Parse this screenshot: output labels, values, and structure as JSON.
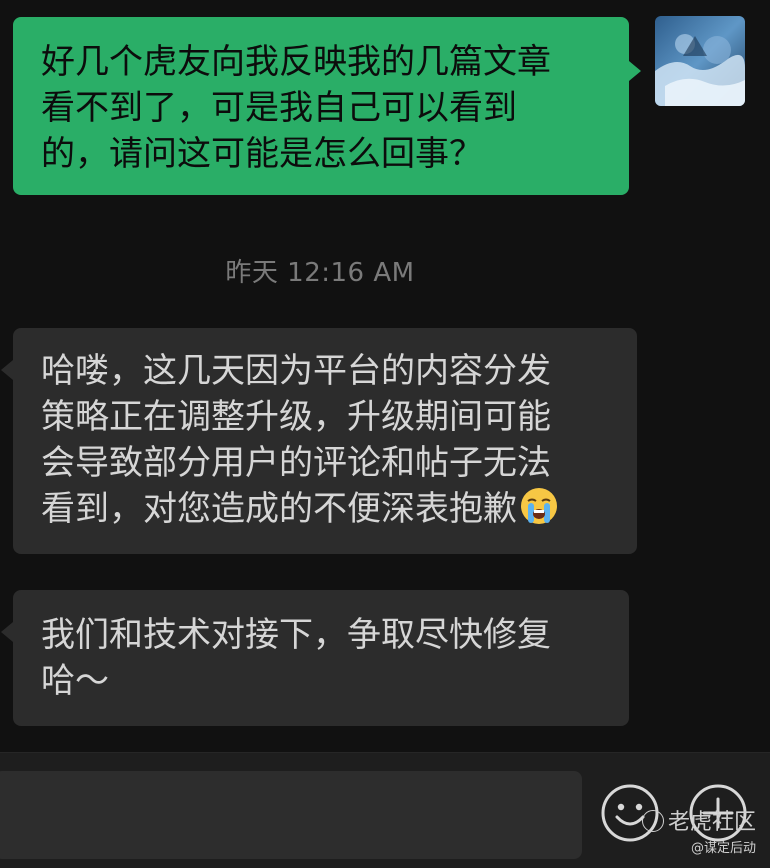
{
  "messages": {
    "outgoing": {
      "lines": [
        "好几个虎友向我反映我的几篇文章",
        "看不到了，可是我自己可以看到",
        "的，请问这可能是怎么回事？"
      ]
    },
    "timestamp": "昨天 12:16 AM",
    "incoming_1": {
      "lines": [
        "哈喽，这几天因为平台的内容分发",
        "策略正在调整升级，升级期间可能",
        "会导致部分用户的评论和帖子无法",
        "看到，对您造成的不便深表抱歉"
      ],
      "emoji": "loudly-crying-face"
    },
    "incoming_2": {
      "lines": [
        "我们和技术对接下，争取尽快修复",
        "哈～"
      ]
    }
  },
  "input_bar": {
    "text_value": "",
    "emoji_icon": "smiley-face-icon",
    "plus_icon": "plus-circle-icon"
  },
  "watermark": {
    "brand": "老虎社区",
    "handle": "@谋定后动"
  },
  "colors": {
    "background": "#111111",
    "outgoing_bubble": "#2aae67",
    "incoming_bubble": "#2c2c2c",
    "timestamp_text": "#7a7a7a"
  }
}
